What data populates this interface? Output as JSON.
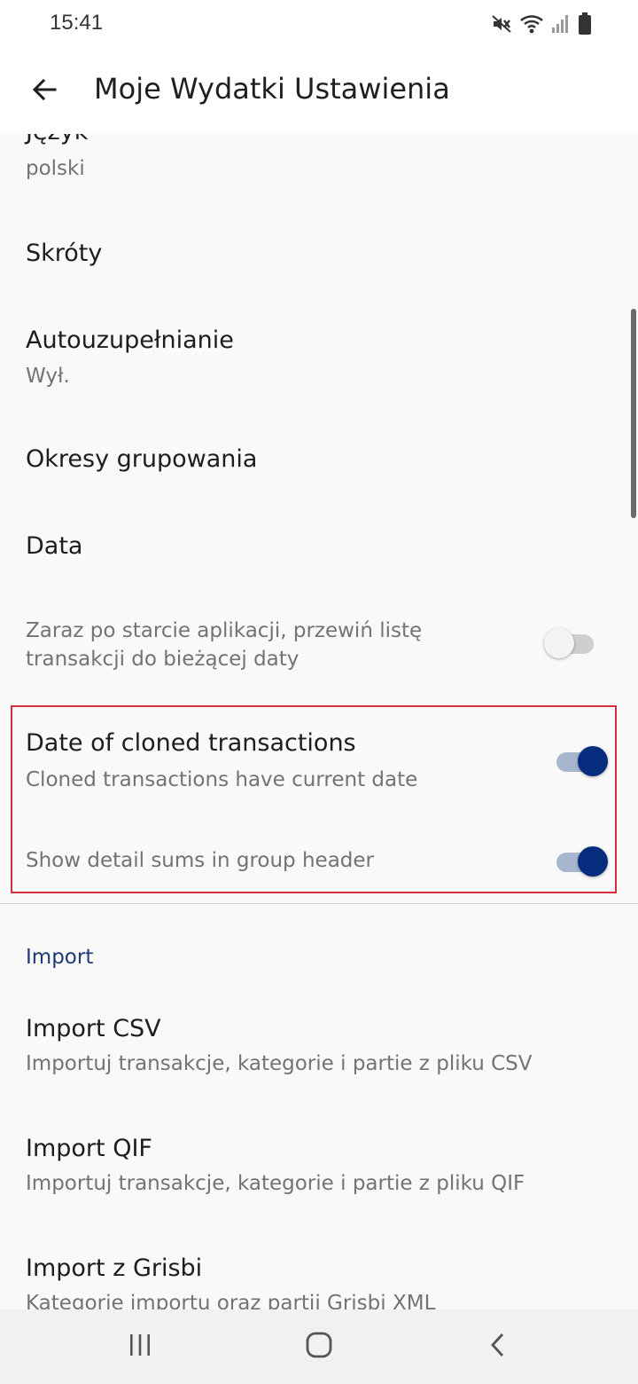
{
  "status_bar": {
    "time": "15:41",
    "icons": [
      "mute-icon",
      "wifi-icon",
      "signal-icon",
      "battery-icon"
    ]
  },
  "app_bar": {
    "back_icon": "arrow-back-icon",
    "title": "Moje Wydatki Ustawienia"
  },
  "preferences": [
    {
      "title": "Język",
      "summary": "polski"
    },
    {
      "title": "Skróty"
    },
    {
      "title": "Autouzupełnianie",
      "summary": "Wył."
    },
    {
      "title": "Okresy grupowania"
    },
    {
      "title": "Data"
    },
    {
      "summary": "Zaraz po starcie aplikacji, przewiń listę",
      "summary_line2": "transakcji do bieżącej daty",
      "switch": "off"
    },
    {
      "title": "Date of cloned transactions",
      "summary": "Cloned transactions have current date",
      "switch": "on"
    },
    {
      "summary": "Show detail sums in group header",
      "switch": "on"
    }
  ],
  "import_section": {
    "category": "Import",
    "items": [
      {
        "title": "Import CSV",
        "summary": "Importuj transakcje, kategorie i partie z pliku CSV"
      },
      {
        "title": "Import QIF",
        "summary": "Importuj transakcje, kategorie i partie z pliku QIF"
      },
      {
        "title": "Import z Grisbi",
        "summary": "Kategorie importu oraz partii Grisbi XML"
      }
    ]
  },
  "colors": {
    "accent": "#062d7d",
    "category_text": "#1d3a78",
    "highlight_border": "#d32f3a"
  },
  "nav_bar": {
    "icons": [
      "recent-apps-icon",
      "home-icon",
      "back-icon"
    ]
  }
}
